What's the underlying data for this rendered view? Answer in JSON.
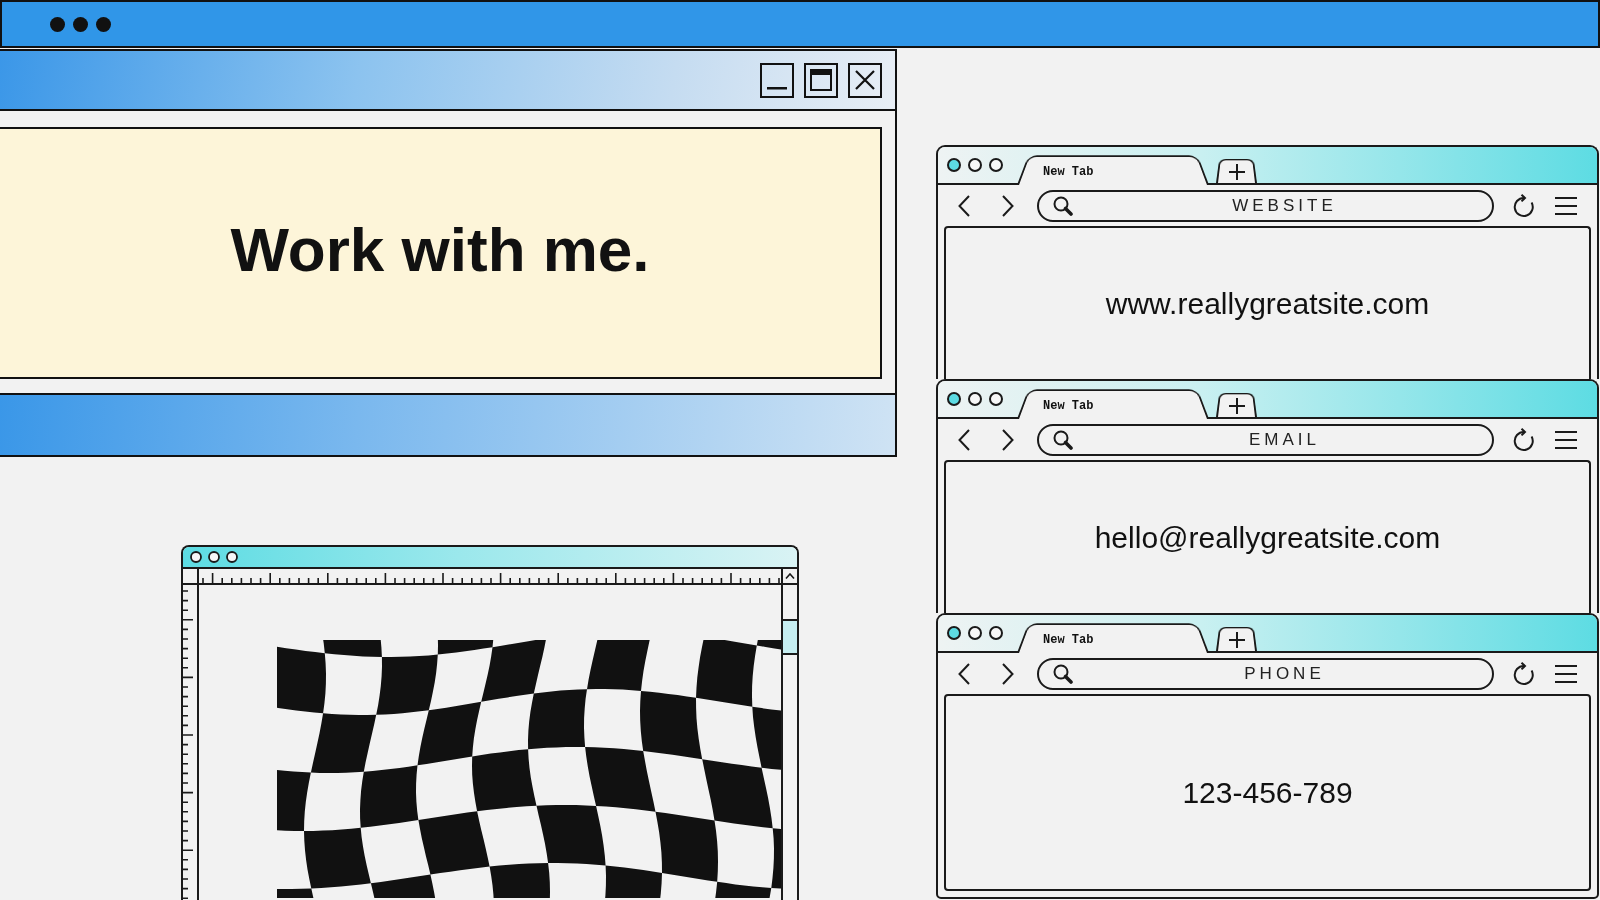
{
  "main_window": {
    "heading": "Work with me."
  },
  "browsers": [
    {
      "tabs": [
        {
          "label": "New Tab",
          "selected": true
        }
      ],
      "address_bar": {
        "value": "WEBSITE"
      },
      "page_text": "www.reallygreatsite.com"
    },
    {
      "tabs": [
        {
          "label": "New Tab",
          "selected": true
        }
      ],
      "address_bar": {
        "value": "EMAIL"
      },
      "page_text": "hello@reallygreatsite.com"
    },
    {
      "tabs": [
        {
          "label": "New Tab",
          "selected": true
        }
      ],
      "address_bar": {
        "value": "PHONE"
      },
      "page_text": "123-456-789"
    }
  ]
}
